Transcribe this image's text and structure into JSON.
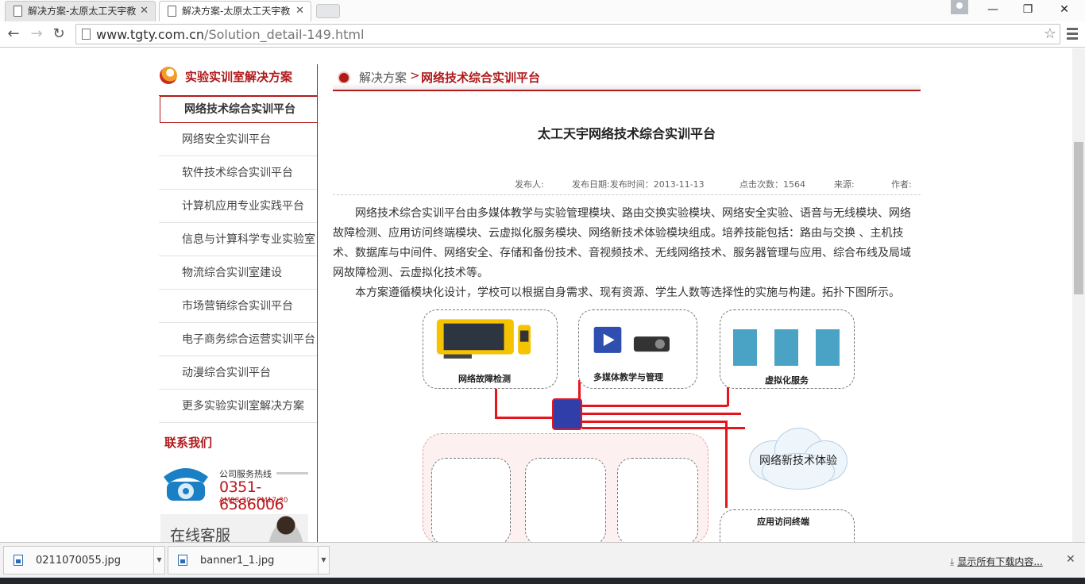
{
  "browser": {
    "tabs": [
      {
        "title": "解决方案-太原太工天宇教"
      },
      {
        "title": "解决方案-太原太工天宇教"
      }
    ],
    "url_host": "www.tgty.com.cn",
    "url_path": "/Solution_detail-149.html"
  },
  "sidebar": {
    "title": "实验实训室解决方案",
    "items": [
      {
        "label": "网络技术综合实训平台"
      },
      {
        "label": "网络安全实训平台"
      },
      {
        "label": "软件技术综合实训平台"
      },
      {
        "label": "计算机应用专业实践平台"
      },
      {
        "label": "信息与计算科学专业实验室"
      },
      {
        "label": "物流综合实训室建设"
      },
      {
        "label": "市场营销综合实训平台"
      },
      {
        "label": "电子商务综合运营实训平台"
      },
      {
        "label": "动漫综合实训平台"
      },
      {
        "label": "更多实验实训室解决方案"
      }
    ],
    "contact_title": "联系我们",
    "hotline_label": "公司服务热线",
    "hotline_number": "0351-6586006",
    "hotline_hours": "AM08:30~PM17:30",
    "online_service": "在线客服"
  },
  "breadcrumb": {
    "root": "解决方案",
    "separator": ">",
    "current": "网络技术综合实训平台"
  },
  "article": {
    "title": "太工天宇网络技术综合实训平台",
    "meta": {
      "publisher": "发布人:",
      "date": "发布日期:发布时间：2013-11-13",
      "views": "点击次数：1564",
      "source": "来源:",
      "author": "作者:"
    },
    "paragraphs": [
      "网络技术综合实训平台由多媒体教学与实验管理模块、路由交换实验模块、网络安全实验、语音与无线模块、网络故障检测、应用访问终端模块、云虚拟化服务模块、网络新技术体验模块组成。培养技能包括：路由与交换 、主机技术、数据库与中间件、网络安全、存储和备份技术、音视频技术、无线网络技术、服务器管理与应用、综合布线及局域网故障检测、云虚拟化技术等。",
      "本方案遵循模块化设计，学校可以根据自身需求、现有资源、学生人数等选择性的实施与构建。拓扑下图所示。"
    ]
  },
  "diagram": {
    "nodes": [
      {
        "label": "网络故障检测"
      },
      {
        "label": "多媒体教学与管理"
      },
      {
        "label": "虚拟化服务"
      },
      {
        "label": "网络新技术体验"
      },
      {
        "label": "应用访问终端"
      }
    ],
    "line_color": "#e8141b"
  },
  "downloads": {
    "items": [
      {
        "name": "0211070055.jpg"
      },
      {
        "name": "banner1_1.jpg"
      }
    ],
    "show_all": "显示所有下载内容..."
  }
}
